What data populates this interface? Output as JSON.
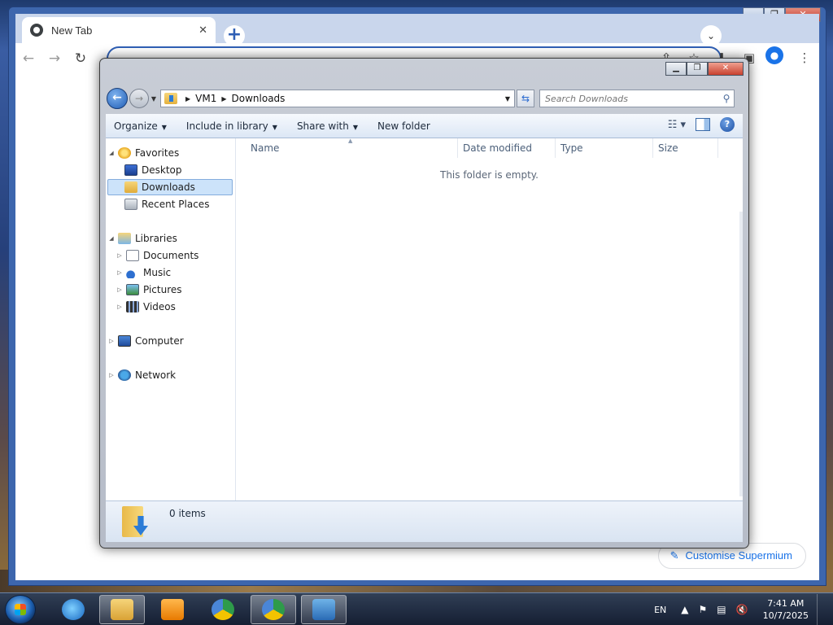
{
  "browser": {
    "tab_title": "New Tab",
    "tab_close": "✕",
    "new_tab": "+",
    "customise_label": "Customise Supermium"
  },
  "explorer": {
    "breadcrumb": [
      "VM1",
      "Downloads"
    ],
    "search_placeholder": "Search Downloads",
    "commands": [
      {
        "label": "Organize",
        "dropdown": true
      },
      {
        "label": "Include in library",
        "dropdown": true
      },
      {
        "label": "Share with",
        "dropdown": true
      },
      {
        "label": "New folder",
        "dropdown": false
      }
    ],
    "nav": {
      "favorites": "Favorites",
      "desktop": "Desktop",
      "downloads": "Downloads",
      "recent_places": "Recent Places",
      "libraries": "Libraries",
      "documents": "Documents",
      "music": "Music",
      "pictures": "Pictures",
      "videos": "Videos",
      "computer": "Computer",
      "network": "Network"
    },
    "selected_nav": "Downloads",
    "columns": [
      "Name",
      "Date modified",
      "Type",
      "Size"
    ],
    "empty_message": "This folder is empty.",
    "items_count": "0 items"
  },
  "taskbar": {
    "language": "EN",
    "time": "7:41 AM",
    "date": "10/7/2025"
  },
  "colors": {
    "chrome_frame": "#3d66ad",
    "accent": "#1a73e8",
    "selection": "#cce3fa"
  }
}
